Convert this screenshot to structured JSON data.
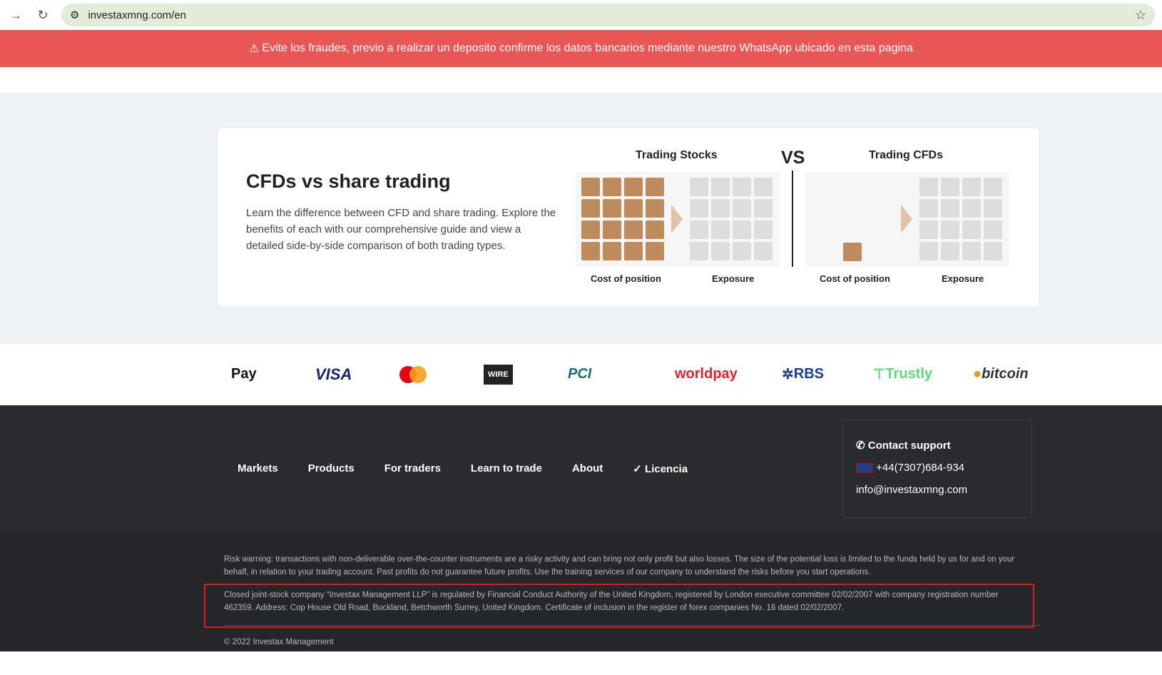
{
  "browser": {
    "url": "investaxmng.com/en"
  },
  "alert": {
    "text": "Evite los fraudes, previo a realizar un deposito confirme los datos bancarios mediante nuestro WhatsApp ubicado en esta pagina"
  },
  "card": {
    "title": "CFDs vs share trading",
    "description": "Learn the difference between CFD and share trading. Explore the benefits of each with our comprehensive guide and view a detailed side-by-side comparison of both trading types.",
    "stocks_title": "Trading Stocks",
    "cfds_title": "Trading CFDs",
    "vs": "VS",
    "cost_label": "Cost of position",
    "exposure_label": "Exposure"
  },
  "payments": [
    "Pay",
    "VISA",
    "mastercard",
    "WIRE",
    "PCI",
    "worldpay",
    "RBS",
    "Trustly",
    "bitcoin"
  ],
  "footer": {
    "menu": [
      "Markets",
      "Products",
      "For traders",
      "Learn to trade",
      "About",
      "Licencia"
    ],
    "contact_title": "Contact support",
    "phone": "+44(7307)684-934",
    "email": "info@investaxmng.com"
  },
  "legal": {
    "risk": "Risk warning: transactions with non-deliverable over-the-counter instruments are a risky activity and can bring not only profit but also losses. The size of the potential loss is limited to the funds held by us for and on your behalf, in relation to your trading account. Past profits do not guarantee future profits. Use the training services of our company to understand the risks before you start operations.",
    "company_pre": "Closed joint-stock company “",
    "company_link": "Investax Management LLP",
    "company_post": "” is regulated by Financial Conduct Authority of the United Kingdom, registered by London executive committee 02/02/2007 with company registration number 462359. Address: Cop House Old Road, Buckland, Betchworth Surrey, United Kingdom. Certificate of inclusion in the register of forex companies No. 16 dated 02/02/2007.",
    "copyright": "© 2022 Investax Management"
  },
  "colors": {
    "alert": "#e85656",
    "brown": "#bf8a5c",
    "footer": "#2a2b2f"
  }
}
